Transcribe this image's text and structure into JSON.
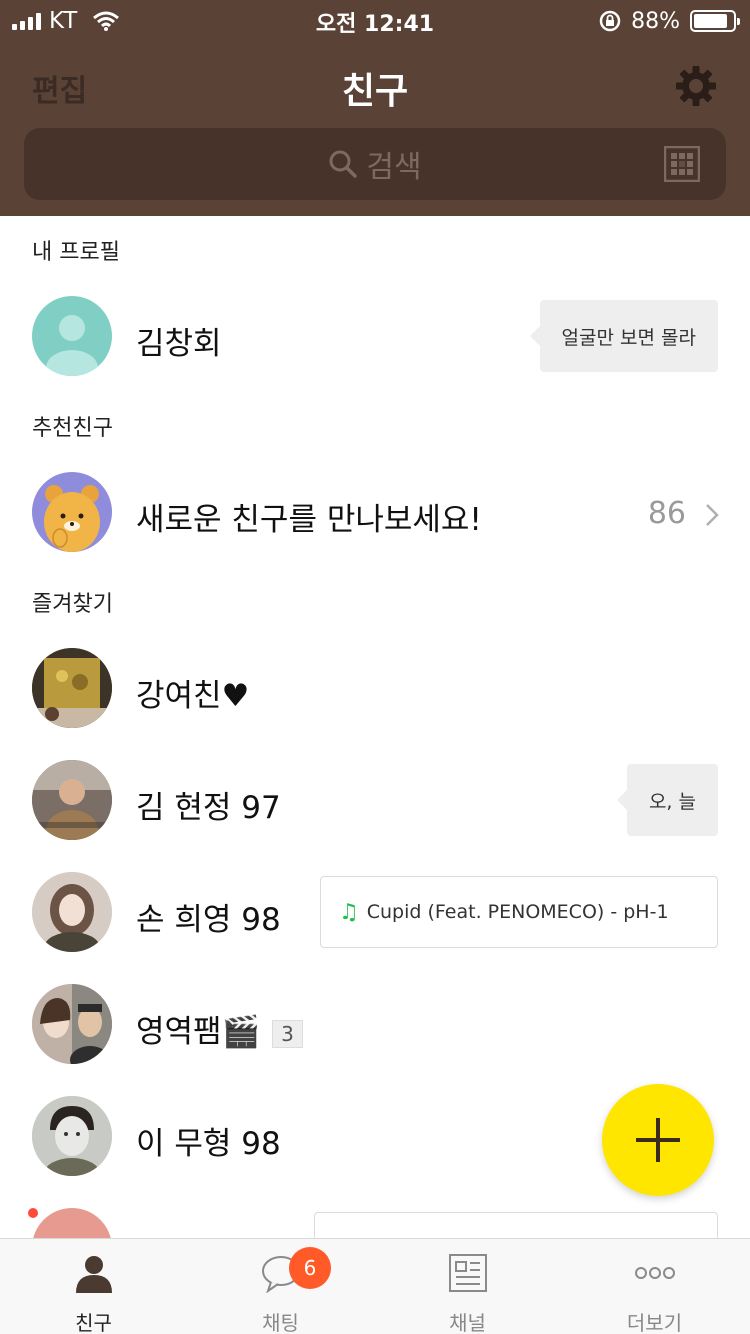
{
  "status_bar": {
    "carrier": "KT",
    "time": "오전 12:41",
    "battery": "88%",
    "battery_level": 0.88
  },
  "nav": {
    "edit_label": "편집",
    "title": "친구",
    "settings_icon": "gear-icon"
  },
  "search": {
    "placeholder": "검색",
    "icon": "search-icon",
    "qr_icon": "qr-code-icon"
  },
  "sections": {
    "my_profile": "내 프로필",
    "recommended": "추천친구",
    "favorites": "즐겨찾기"
  },
  "my_profile": {
    "name": "김창회",
    "status": "얼굴만 보면 몰라"
  },
  "recommended": {
    "label": "새로운 친구를 만나보세요!",
    "count": "86"
  },
  "favorites": [
    {
      "name": "강여친♥",
      "status": ""
    },
    {
      "name": "김 현정 97",
      "status": "오, 늘"
    },
    {
      "name": "손 희영 98",
      "music": "Cupid (Feat. PENOMECO) - pH-1"
    },
    {
      "name": "영역팸🎬",
      "count": "3"
    },
    {
      "name": "이 무형 98"
    },
    {
      "name": "",
      "music": ""
    }
  ],
  "tabs": [
    {
      "label": "친구",
      "icon": "person-icon",
      "active": true
    },
    {
      "label": "채팅",
      "icon": "chat-bubble-icon",
      "badge": "6"
    },
    {
      "label": "채널",
      "icon": "channel-icon"
    },
    {
      "label": "더보기",
      "icon": "more-icon"
    }
  ],
  "colors": {
    "header": "#5a4237",
    "search_bg": "#473329",
    "fab": "#ffe600",
    "badge": "#ff5a28",
    "music_note": "#22c14a"
  }
}
